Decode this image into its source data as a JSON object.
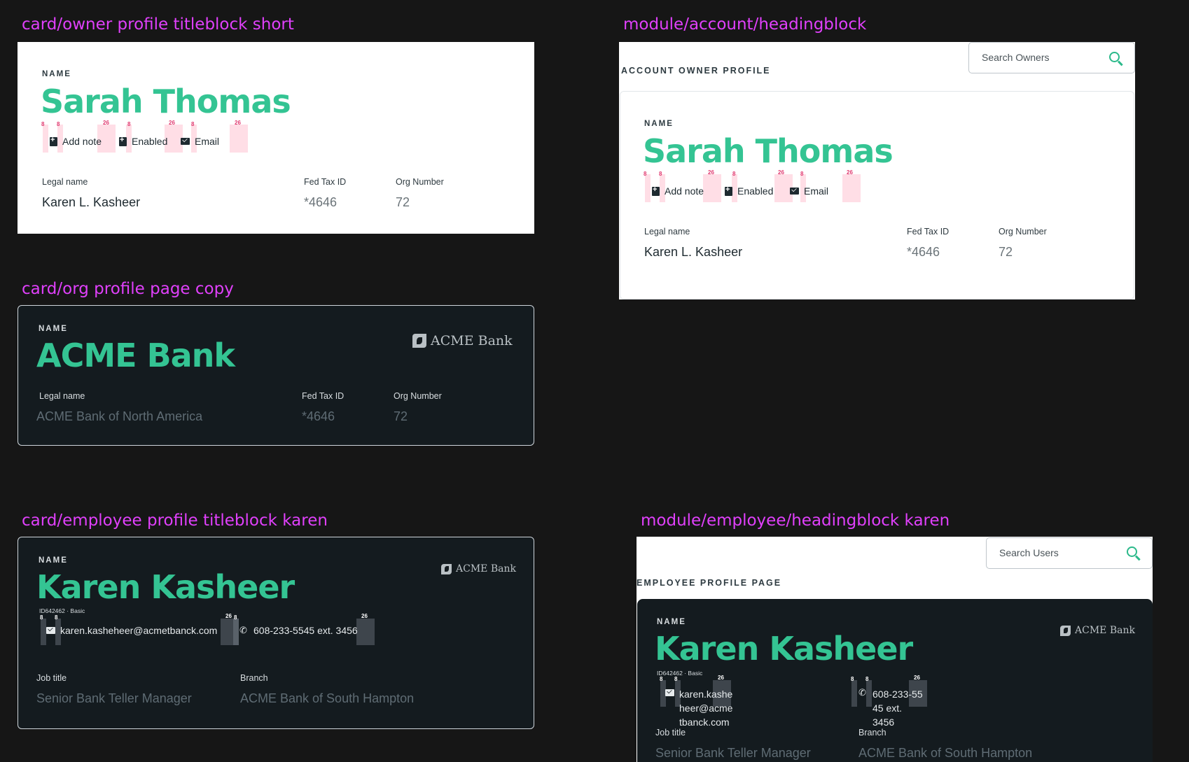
{
  "frames": {
    "owner_short": "card/owner profile titleblock short",
    "account_heading": "module/account/headingblock",
    "org_copy": "card/org profile page copy",
    "employee_titleblock": "card/employee profile titleblock karen",
    "employee_heading": "module/employee/headingblock karen"
  },
  "owner": {
    "name_label": "NAME",
    "name": "Sarah Thomas",
    "actions": {
      "add_note": "Add note",
      "enabled": "Enabled",
      "email": "Email"
    },
    "fields": {
      "legal_name_label": "Legal name",
      "legal_name": "Karen L. Kasheer",
      "tax_label": "Fed Tax ID",
      "tax": "*4646",
      "org_label": "Org Number",
      "org": "72"
    }
  },
  "account_module": {
    "heading": "ACCOUNT OWNER PROFILE",
    "search_placeholder": "Search Owners"
  },
  "org": {
    "name_label": "NAME",
    "name": "ACME Bank",
    "logo_text": "ACME Bank",
    "fields": {
      "legal_name_label": "Legal name",
      "legal_name": "ACME Bank of North America",
      "tax_label": "Fed Tax ID",
      "tax": "*4646",
      "org_label": "Org Number",
      "org": "72"
    }
  },
  "employee": {
    "name_label": "NAME",
    "name": "Karen Kasheer",
    "id_line": "ID642462 · Basic",
    "email": "karen.kasheheer@acmetbanck.com",
    "email_wrapped": [
      "karen.kashe",
      "heer@acme",
      "tbanck.com"
    ],
    "phone": "608-233-5545  ext. 3456",
    "phone_wrapped": [
      "608-233-55",
      "45  ext.",
      "3456"
    ],
    "logo_text": "ACME Bank",
    "job_title_label": "Job title",
    "job_title": "Senior Bank Teller Manager",
    "branch_label": "Branch",
    "branch": "ACME Bank of South Hampton"
  },
  "employee_module": {
    "heading": "EMPLOYEE PROFILE PAGE",
    "search_placeholder": "Search Users"
  },
  "spacing": {
    "s8": "8",
    "s26": "26"
  },
  "colors": {
    "accent": "#34c493",
    "frame_label": "#e040fb",
    "dark_card": "#141b1f",
    "page": "#161616"
  }
}
